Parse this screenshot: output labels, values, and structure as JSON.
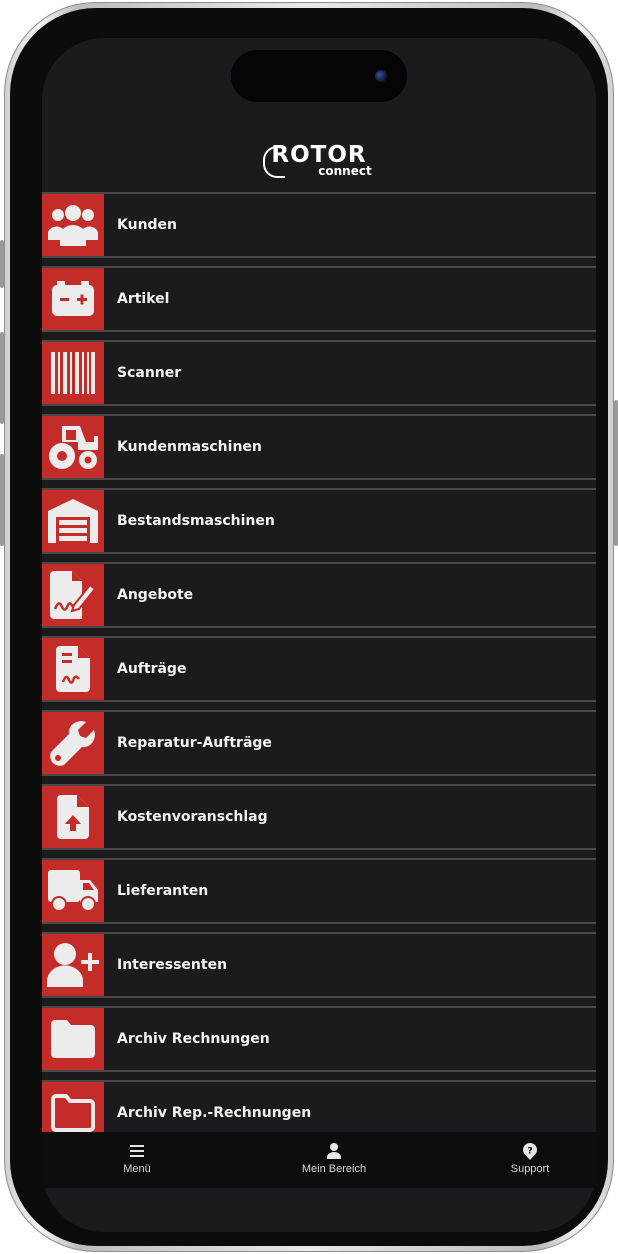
{
  "app": {
    "logo_main": "ROTOR",
    "logo_sub": "connect"
  },
  "colors": {
    "accent": "#c42c2a",
    "background": "#1b1b1d",
    "divider": "#4a4a4c",
    "text": "#f2f2f2"
  },
  "menu": {
    "items": [
      {
        "label": "Kunden",
        "icon": "users-icon"
      },
      {
        "label": "Artikel",
        "icon": "battery-icon"
      },
      {
        "label": "Scanner",
        "icon": "barcode-icon"
      },
      {
        "label": "Kundenmaschinen",
        "icon": "tractor-icon"
      },
      {
        "label": "Bestandsmaschinen",
        "icon": "warehouse-icon"
      },
      {
        "label": "Angebote",
        "icon": "signed-document-icon"
      },
      {
        "label": "Aufträge",
        "icon": "document-signature-icon"
      },
      {
        "label": "Reparatur-Aufträge",
        "icon": "wrench-icon"
      },
      {
        "label": "Kostenvoranschlag",
        "icon": "file-upload-icon"
      },
      {
        "label": "Lieferanten",
        "icon": "truck-icon"
      },
      {
        "label": "Interessenten",
        "icon": "add-user-icon"
      },
      {
        "label": "Archiv Rechnungen",
        "icon": "folder-icon"
      },
      {
        "label": "Archiv Rep.-Rechnungen",
        "icon": "folder-outline-icon"
      }
    ]
  },
  "tabbar": {
    "tabs": [
      {
        "label": "Menü",
        "icon": "hamburger-icon"
      },
      {
        "label": "Mein Bereich",
        "icon": "user-icon"
      },
      {
        "label": "Support",
        "icon": "help-icon"
      }
    ]
  }
}
